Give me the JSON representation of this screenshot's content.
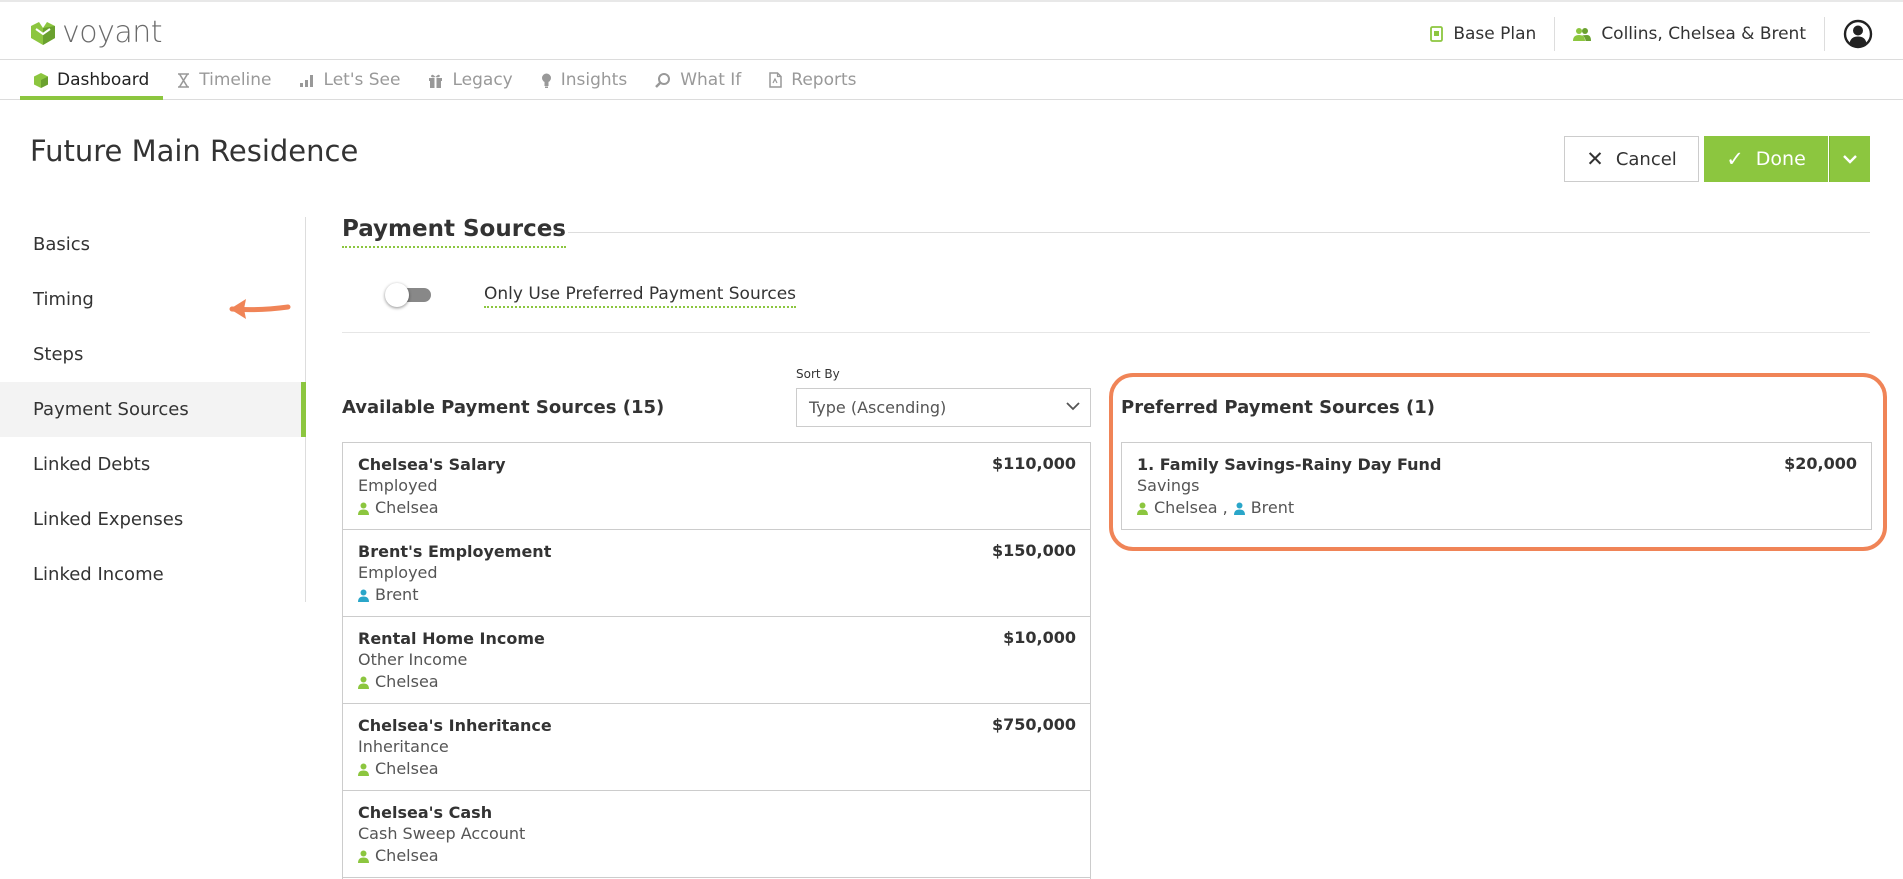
{
  "app": {
    "brand": "voyant",
    "plan_label": "Base Plan",
    "client_label": "Collins, Chelsea & Brent"
  },
  "nav": {
    "tabs": [
      {
        "label": "Dashboard",
        "icon": "cube-icon",
        "active": true
      },
      {
        "label": "Timeline",
        "icon": "hourglass-icon"
      },
      {
        "label": "Let's See",
        "icon": "bar-chart-icon"
      },
      {
        "label": "Legacy",
        "icon": "gift-icon"
      },
      {
        "label": "Insights",
        "icon": "lightbulb-icon"
      },
      {
        "label": "What If",
        "icon": "magnifier-icon"
      },
      {
        "label": "Reports",
        "icon": "document-icon"
      }
    ]
  },
  "page": {
    "title": "Future Main Residence",
    "cancel_label": "Cancel",
    "done_label": "Done"
  },
  "sidebar": {
    "items": [
      {
        "label": "Basics"
      },
      {
        "label": "Timing"
      },
      {
        "label": "Steps"
      },
      {
        "label": "Payment Sources",
        "active": true
      },
      {
        "label": "Linked Debts"
      },
      {
        "label": "Linked Expenses"
      },
      {
        "label": "Linked Income"
      }
    ]
  },
  "section": {
    "title": "Payment Sources",
    "toggle_label": "Only Use Preferred Payment Sources",
    "toggle_on": false
  },
  "available": {
    "title": "Available Payment Sources (15)",
    "sort_label": "Sort By",
    "sort_value": "Type (Ascending)",
    "items": [
      {
        "name": "Chelsea's Salary",
        "type": "Employed",
        "owner": "Chelsea",
        "owner_color": "#8cc63f",
        "amount": "$110,000"
      },
      {
        "name": "Brent's Employement",
        "type": "Employed",
        "owner": "Brent",
        "owner_color": "#2aa6c9",
        "amount": "$150,000"
      },
      {
        "name": "Rental Home Income",
        "type": "Other Income",
        "owner": "Chelsea",
        "owner_color": "#8cc63f",
        "amount": "$10,000"
      },
      {
        "name": "Chelsea's Inheritance",
        "type": "Inheritance",
        "owner": "Chelsea",
        "owner_color": "#8cc63f",
        "amount": "$750,000"
      },
      {
        "name": "Chelsea's Cash",
        "type": "Cash Sweep Account",
        "owner": "Chelsea",
        "owner_color": "#8cc63f",
        "amount": ""
      }
    ]
  },
  "preferred": {
    "title": "Preferred Payment Sources (1)",
    "items": [
      {
        "name": "1. Family Savings-Rainy Day Fund",
        "type": "Savings",
        "owner1": "Chelsea",
        "owner2": "Brent",
        "separator": ",",
        "amount": "$20,000"
      }
    ]
  },
  "colors": {
    "accent": "#8cc63f",
    "highlight": "#f08457",
    "person_blue": "#2aa6c9"
  }
}
